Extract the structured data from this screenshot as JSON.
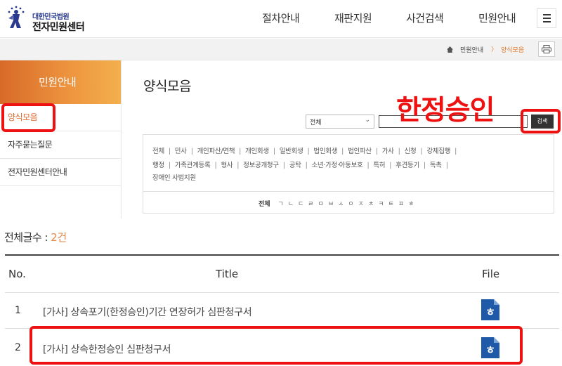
{
  "header": {
    "logo_sub": "대한민국법원",
    "logo_main": "전자민원센터",
    "nav": [
      "절차안내",
      "재판지원",
      "사건검색",
      "민원안내"
    ]
  },
  "breadcrumb": {
    "home": "민원안내",
    "current": "양식모음",
    "separator": "〉"
  },
  "sidebar": {
    "title": "민원안내",
    "items": [
      {
        "label": "양식모음"
      },
      {
        "label": "자주묻는질문"
      },
      {
        "label": "전자민원센터안내"
      }
    ]
  },
  "main": {
    "title": "양식모음",
    "search": {
      "category": "전체",
      "query": "",
      "button": "검색"
    },
    "categories_line1": [
      "전체",
      "민사",
      "개인파산/면책",
      "개인회생",
      "일반회생",
      "법인회생",
      "법인파산",
      "가사",
      "신청",
      "강제집행"
    ],
    "categories_line2": [
      "행정",
      "가족관계등록",
      "형사",
      "정보공개청구",
      "공탁",
      "소년·가정·아동보호",
      "특허",
      "후견등기",
      "독촉"
    ],
    "categories_line3": [
      "장애인 사법지원"
    ],
    "consonants_all": "전체",
    "consonants": [
      "ㄱ",
      "ㄴ",
      "ㄷ",
      "ㄹ",
      "ㅁ",
      "ㅂ",
      "ㅅ",
      "ㅇ",
      "ㅈ",
      "ㅊ",
      "ㅋ",
      "ㅌ",
      "ㅍ",
      "ㅎ"
    ],
    "count_label": "전체글수 : ",
    "count_value": "2건"
  },
  "table": {
    "headers": [
      "No.",
      "Title",
      "File"
    ],
    "rows": [
      {
        "no": "1",
        "title": "[가사] 상속포기(한정승인)기간 연장허가 심판청구서",
        "file": "hwp-icon"
      },
      {
        "no": "2",
        "title": "[가사] 상속한정승인 심판청구서",
        "file": "hwp-icon"
      }
    ]
  },
  "annotation": {
    "text": "한정승인",
    "color": "#ee1111"
  },
  "colors": {
    "accent": "#e06b2c",
    "sidebar_gradient": [
      "#d86a28",
      "#f3b04c"
    ],
    "annotation": "#ee1111"
  }
}
